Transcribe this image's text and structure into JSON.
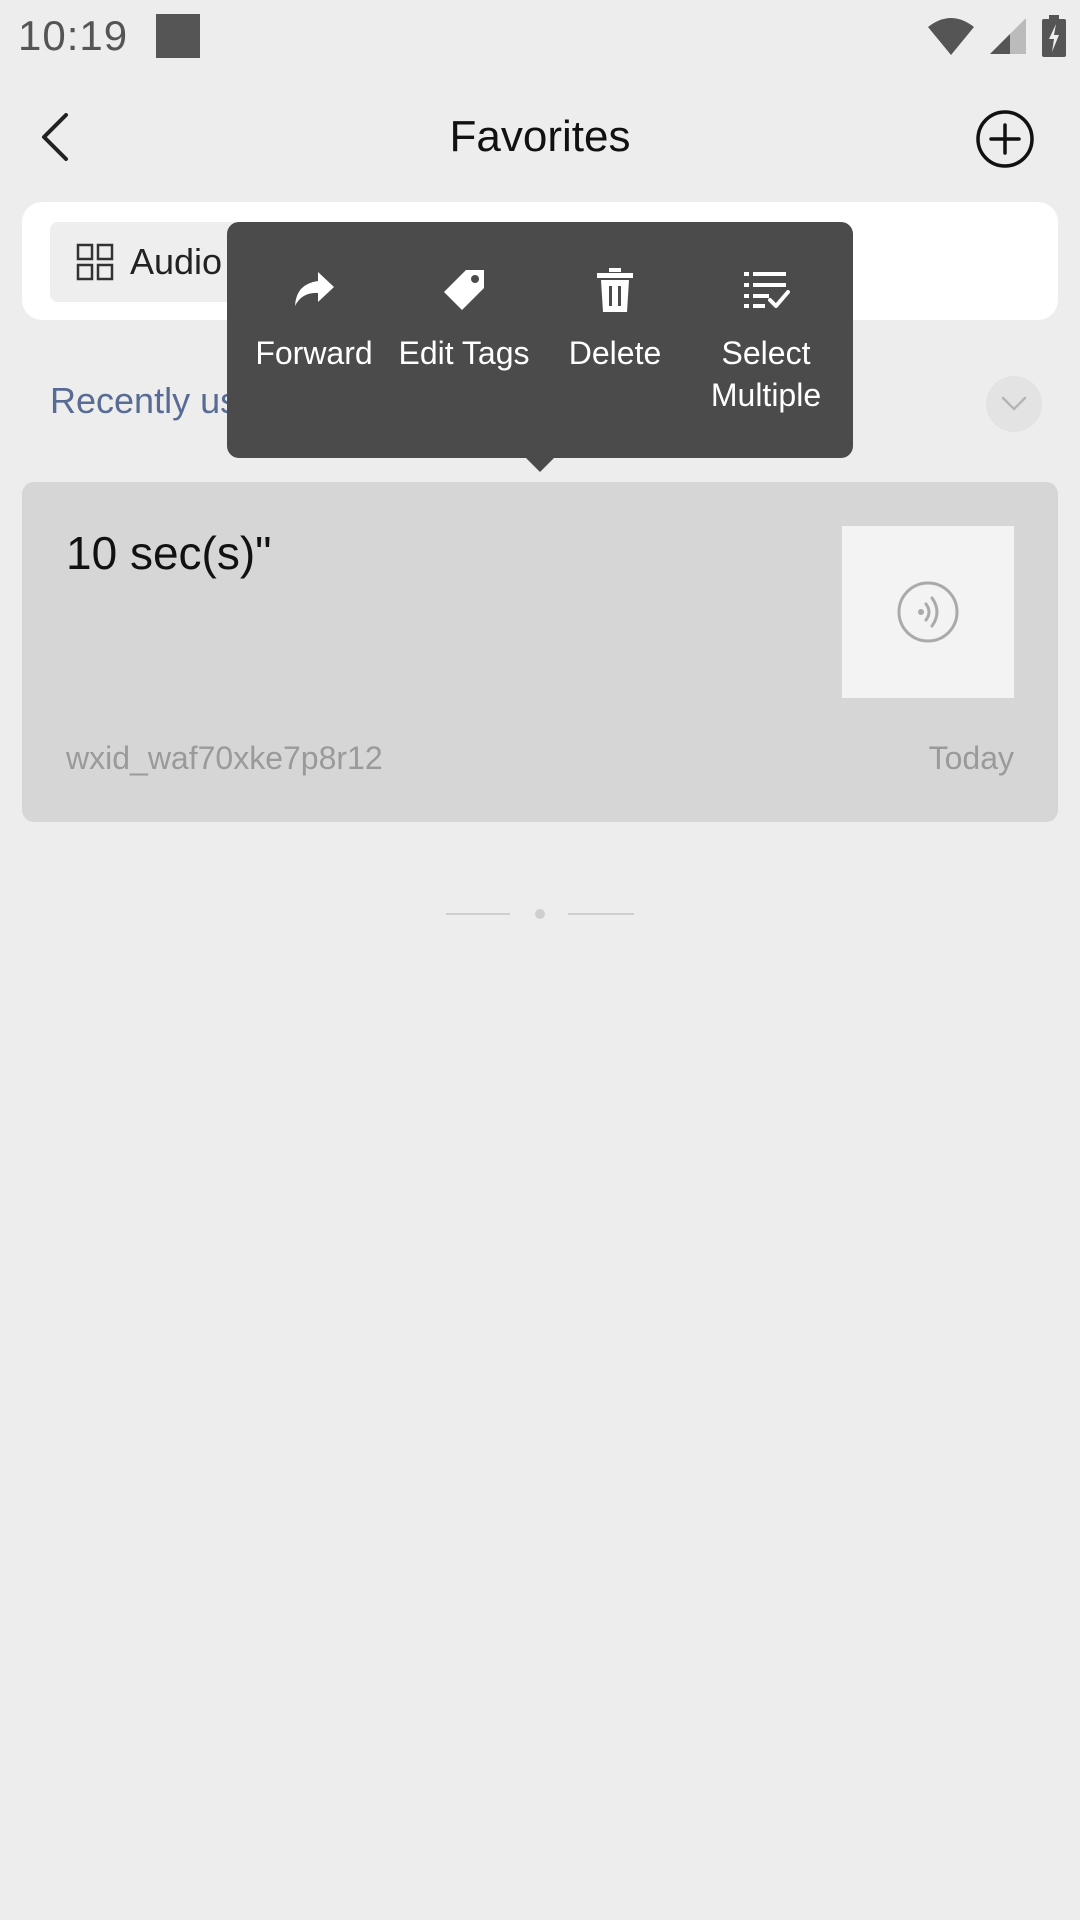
{
  "status_bar": {
    "time": "10:19"
  },
  "header": {
    "title": "Favorites"
  },
  "filter": {
    "chip_label": "Audio"
  },
  "recent": {
    "label": "Recently us"
  },
  "favorite_item": {
    "duration": "10 sec(s)\"",
    "source": "wxid_waf70xke7p8r12",
    "date": "Today"
  },
  "context_menu": {
    "items": [
      {
        "label": "Forward",
        "icon": "forward-icon"
      },
      {
        "label": "Edit Tags",
        "icon": "tag-icon"
      },
      {
        "label": "Delete",
        "icon": "trash-icon"
      },
      {
        "label": "Select\nMultiple",
        "icon": "select-multiple-icon"
      }
    ]
  },
  "colors": {
    "background": "#ededed",
    "link": "#576b95",
    "popup": "#4b4b4b"
  }
}
